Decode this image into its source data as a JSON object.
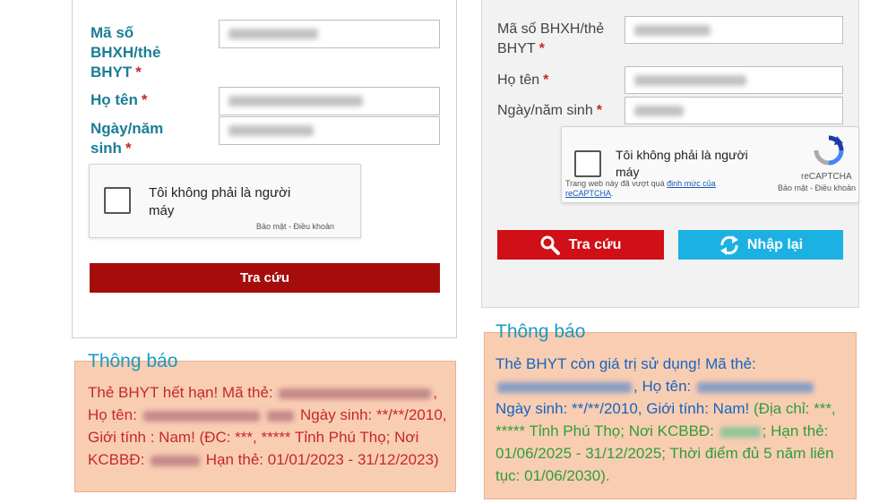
{
  "left": {
    "form": {
      "bhxh_label_line1": "Mã số",
      "bhxh_label_line2": "BHXH/thẻ",
      "bhxh_label_line3": "BHYT",
      "name_label": "Họ tên",
      "dob_label_line1": "Ngày/năm",
      "dob_label_line2": "sinh",
      "required_mark": "*"
    },
    "captcha": {
      "text_line1": "Tôi không phải là người",
      "text_line2": "máy",
      "footer": "Bảo mật - Điều khoản"
    },
    "submit_label": "Tra cứu",
    "notice": {
      "title": "Thông báo",
      "part1": "Thẻ BHYT hết hạn! Mã thẻ:",
      "part2": ", Họ tên:",
      "part3": "Ngày sinh: **/**/2010, Giới tính : Nam! (ĐC: ***, ***** Tỉnh Phú Thọ; Nơi KCBBĐ:",
      "part4": "Hạn thẻ: 01/01/2023 - 31/12/2023)"
    }
  },
  "right": {
    "form": {
      "bhxh_label_line1": "Mã số BHXH/thẻ",
      "bhxh_label_line2": "BHYT",
      "name_label": "Họ tên",
      "dob_label": "Ngày/năm sinh",
      "required_mark": "*"
    },
    "captcha": {
      "text_line1": "Tôi không phải là người",
      "text_line2": "máy",
      "warn_line1": "Trang web này đã vượt quá",
      "warn_link": "định mức của",
      "warn_line2": "reCAPTCHA",
      "brand": "reCAPTCHA",
      "footer": "Bảo mật - Điều khoản"
    },
    "search_label": "Tra cứu",
    "reset_label": "Nhập lại",
    "notice": {
      "title": "Thông báo",
      "part1": "Thẻ BHYT còn giá trị sử dụng! Mã thẻ:",
      "part2": ", Họ tên:",
      "part3": "Ngày sinh: **/**/2010, Giới tính: Nam!",
      "part4": "(Địa chỉ: ***, ***** Tỉnh Phú Thọ; Nơi KCBBĐ:",
      "part5": "; Hạn thẻ: 01/06/2025 - 31/12/2025; Thời điểm đủ 5 năm liên tục: 01/06/2030)."
    }
  },
  "colors": {
    "left_button": "#a50d0d",
    "right_search_button": "#d10f16",
    "right_reset_button": "#1cb1e3",
    "notice_bg": "#f9cdb2",
    "expired_text": "#c62828",
    "valid_blue": "#1565c0",
    "valid_green": "#2e9e3a"
  }
}
